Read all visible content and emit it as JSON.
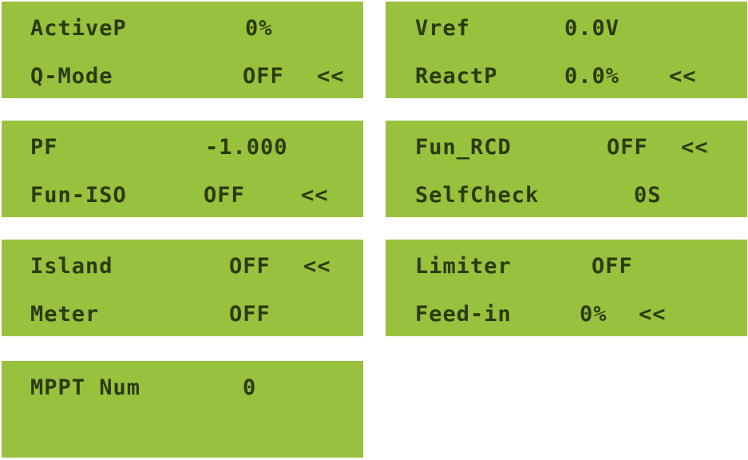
{
  "colors": {
    "lcd_background": "#98c13d",
    "lcd_text": "#2c3a10",
    "page_background": "#ffffff"
  },
  "screens": [
    {
      "row1": {
        "label": "ActiveP",
        "value": "0%",
        "marker": ""
      },
      "row2": {
        "label": "Q-Mode",
        "value": "OFF",
        "marker": "<<"
      }
    },
    {
      "row1": {
        "label": "Vref",
        "value": "0.0V",
        "marker": ""
      },
      "row2": {
        "label": "ReactP",
        "value": "0.0%",
        "marker": "<<"
      }
    },
    {
      "row1": {
        "label": "PF",
        "value": "-1.000",
        "marker": ""
      },
      "row2": {
        "label": "Fun-ISO",
        "value": "OFF",
        "marker": "<<"
      }
    },
    {
      "row1": {
        "label": "Fun_RCD",
        "value": "OFF",
        "marker": "<<"
      },
      "row2": {
        "label": "SelfCheck",
        "value": "0S",
        "marker": ""
      }
    },
    {
      "row1": {
        "label": "Island",
        "value": "OFF",
        "marker": "<<"
      },
      "row2": {
        "label": "Meter",
        "value": "OFF",
        "marker": ""
      }
    },
    {
      "row1": {
        "label": "Limiter",
        "value": "OFF",
        "marker": ""
      },
      "row2": {
        "label": "Feed-in",
        "value": "0%",
        "marker": "<<"
      }
    },
    {
      "row1": {
        "label": "MPPT Num",
        "value": "0",
        "marker": ""
      },
      "row2": {
        "label": "",
        "value": "",
        "marker": ""
      }
    }
  ]
}
